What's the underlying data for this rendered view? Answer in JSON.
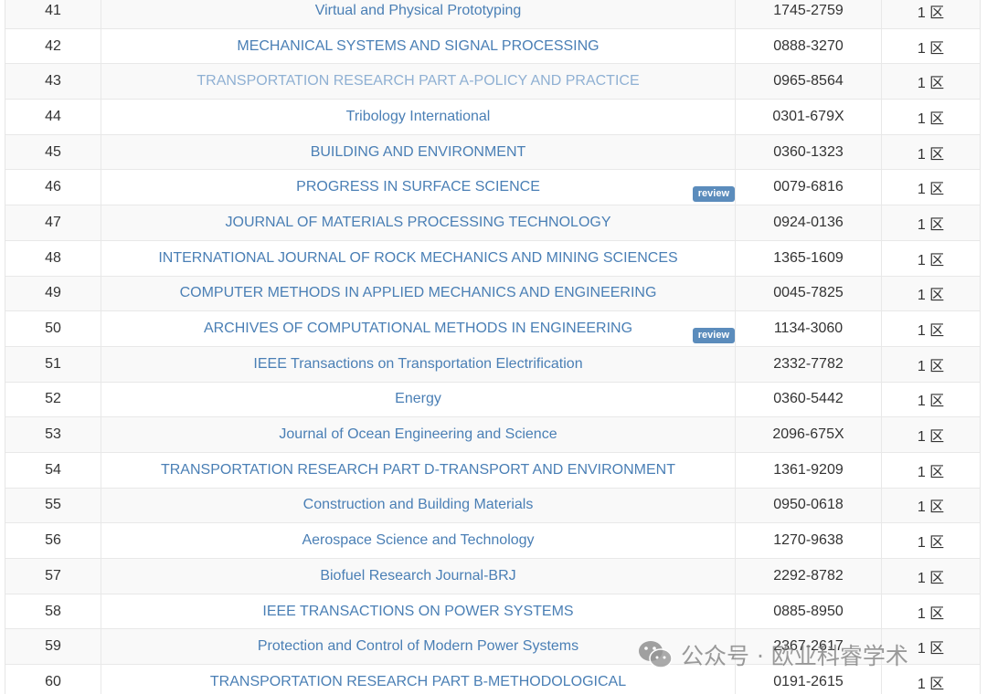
{
  "rows": [
    {
      "num": "41",
      "title": "Virtual and Physical Prototyping",
      "issn": "1745-2759",
      "zone": "1 区"
    },
    {
      "num": "42",
      "title": "MECHANICAL SYSTEMS AND SIGNAL PROCESSING",
      "issn": "0888-3270",
      "zone": "1 区"
    },
    {
      "num": "43",
      "title": "TRANSPORTATION RESEARCH PART A-POLICY AND PRACTICE",
      "issn": "0965-8564",
      "zone": "1 区"
    },
    {
      "num": "44",
      "title": "Tribology International",
      "issn": "0301-679X",
      "zone": "1 区"
    },
    {
      "num": "45",
      "title": "BUILDING AND ENVIRONMENT",
      "issn": "0360-1323",
      "zone": "1 区"
    },
    {
      "num": "46",
      "title": "PROGRESS IN SURFACE SCIENCE",
      "issn": "0079-6816",
      "zone": "1 区",
      "badge": "review"
    },
    {
      "num": "47",
      "title": "JOURNAL OF MATERIALS PROCESSING TECHNOLOGY",
      "issn": "0924-0136",
      "zone": "1 区"
    },
    {
      "num": "48",
      "title": "INTERNATIONAL JOURNAL OF ROCK MECHANICS AND MINING SCIENCES",
      "issn": "1365-1609",
      "zone": "1 区"
    },
    {
      "num": "49",
      "title": "COMPUTER METHODS IN APPLIED MECHANICS AND ENGINEERING",
      "issn": "0045-7825",
      "zone": "1 区"
    },
    {
      "num": "50",
      "title": "ARCHIVES OF COMPUTATIONAL METHODS IN ENGINEERING",
      "issn": "1134-3060",
      "zone": "1 区",
      "badge": "review"
    },
    {
      "num": "51",
      "title": "IEEE Transactions on Transportation Electrification",
      "issn": "2332-7782",
      "zone": "1 区"
    },
    {
      "num": "52",
      "title": "Energy",
      "issn": "0360-5442",
      "zone": "1 区"
    },
    {
      "num": "53",
      "title": "Journal of Ocean Engineering and Science",
      "issn": "2096-675X",
      "zone": "1 区"
    },
    {
      "num": "54",
      "title": "TRANSPORTATION RESEARCH PART D-TRANSPORT AND ENVIRONMENT",
      "issn": "1361-9209",
      "zone": "1 区"
    },
    {
      "num": "55",
      "title": "Construction and Building Materials",
      "issn": "0950-0618",
      "zone": "1 区"
    },
    {
      "num": "56",
      "title": "Aerospace Science and Technology",
      "issn": "1270-9638",
      "zone": "1 区"
    },
    {
      "num": "57",
      "title": "Biofuel Research Journal-BRJ",
      "issn": "2292-8782",
      "zone": "1 区"
    },
    {
      "num": "58",
      "title": "IEEE TRANSACTIONS ON POWER SYSTEMS",
      "issn": "0885-8950",
      "zone": "1 区"
    },
    {
      "num": "59",
      "title": "Protection and Control of Modern Power Systems",
      "issn": "2367-2617",
      "zone": "1 区"
    },
    {
      "num": "60",
      "title": "TRANSPORTATION RESEARCH PART B-METHODOLOGICAL",
      "issn": "0191-2615",
      "zone": "1 区"
    }
  ],
  "watermark": {
    "text": "公众号 · 欧业科睿学术",
    "icon": "wechat-icon"
  },
  "colors": {
    "link": "#4a7fb5",
    "badge_bg": "#5b8cbc",
    "row_alt": "#f9f9f9"
  }
}
